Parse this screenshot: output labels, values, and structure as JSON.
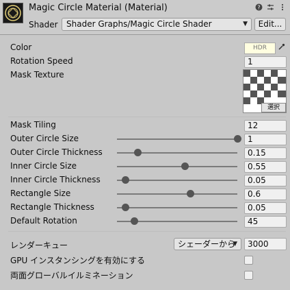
{
  "header": {
    "title": "Magic Circle Material (Material)",
    "shader_label": "Shader",
    "shader_value": "Shader Graphs/Magic Circle Shader",
    "edit_label": "Edit...",
    "icons": [
      "help-icon",
      "preset-icon",
      "more-icon"
    ]
  },
  "properties": {
    "color": {
      "label": "Color",
      "swatch_text": "HDR",
      "swatch_color": "#fffee0"
    },
    "rotation_speed": {
      "label": "Rotation Speed",
      "value": "1"
    },
    "mask_texture": {
      "label": "Mask Texture",
      "select_label": "選択"
    },
    "mask_tiling": {
      "label": "Mask Tiling",
      "value": "12"
    }
  },
  "sliders": [
    {
      "label": "Outer Circle Size",
      "value": "1",
      "fraction": 1.0
    },
    {
      "label": "Outer Circle Thickness",
      "value": "0.15",
      "fraction": 0.17
    },
    {
      "label": "Inner Circle Size",
      "value": "0.55",
      "fraction": 0.56
    },
    {
      "label": "Inner Circle Thickness",
      "value": "0.05",
      "fraction": 0.07
    },
    {
      "label": "Rectangle Size",
      "value": "0.6",
      "fraction": 0.61
    },
    {
      "label": "Rectangle Thickness",
      "value": "0.05",
      "fraction": 0.07
    },
    {
      "label": "Default Rotation",
      "value": "45",
      "fraction": 0.14
    }
  ],
  "advanced": {
    "render_queue": {
      "label": "レンダーキュー",
      "mode": "シェーダーから",
      "value": "3000"
    },
    "gpu_instancing": {
      "label": "GPU インスタンシングを有効にする",
      "checked": false
    },
    "double_sided_gi": {
      "label": "両面グローバルイルミネーション",
      "checked": false
    }
  }
}
